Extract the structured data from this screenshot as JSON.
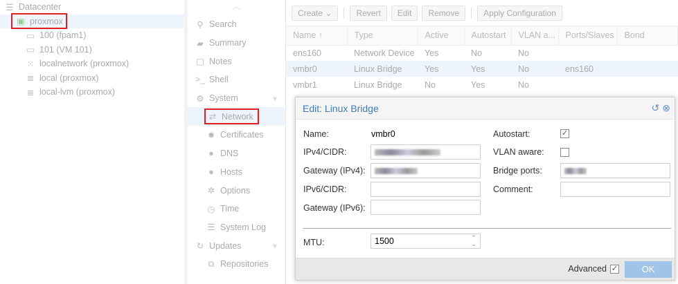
{
  "tree": {
    "items": [
      {
        "label": "Datacenter",
        "icon": "datacenter-icon"
      },
      {
        "label": "proxmox",
        "icon": "node-online-icon"
      },
      {
        "label": "100 (fpam1)",
        "icon": "vm-icon"
      },
      {
        "label": "101 (VM 101)",
        "icon": "vm-icon"
      },
      {
        "label": "localnetwork (proxmox)",
        "icon": "sdn-grid-icon"
      },
      {
        "label": "local (proxmox)",
        "icon": "storage-icon"
      },
      {
        "label": "local-lvm (proxmox)",
        "icon": "storage-icon"
      }
    ]
  },
  "nav": {
    "items": [
      {
        "label": "Search",
        "icon": "search-icon"
      },
      {
        "label": "Summary",
        "icon": "book-icon"
      },
      {
        "label": "Notes",
        "icon": "notes-icon"
      },
      {
        "label": "Shell",
        "icon": "terminal-icon"
      },
      {
        "label": "System",
        "icon": "gears-icon"
      },
      {
        "label": "Network",
        "icon": "exchange-icon"
      },
      {
        "label": "Certificates",
        "icon": "certificate-icon"
      },
      {
        "label": "DNS",
        "icon": "globe-icon"
      },
      {
        "label": "Hosts",
        "icon": "globe-icon"
      },
      {
        "label": "Options",
        "icon": "gear-icon"
      },
      {
        "label": "Time",
        "icon": "clock-icon"
      },
      {
        "label": "System Log",
        "icon": "list-icon"
      },
      {
        "label": "Updates",
        "icon": "refresh-icon"
      },
      {
        "label": "Repositories",
        "icon": "files-icon"
      }
    ]
  },
  "toolbar": {
    "create": "Create",
    "revert": "Revert",
    "edit": "Edit",
    "remove": "Remove",
    "apply": "Apply Configuration"
  },
  "grid": {
    "columns": [
      "Name ↑",
      "Type",
      "Active",
      "Autostart",
      "VLAN a...",
      "Ports/Slaves",
      "Bond"
    ],
    "rows": [
      [
        "ens160",
        "Network Device",
        "Yes",
        "No",
        "No",
        ""
      ],
      [
        "vmbr0",
        "Linux Bridge",
        "Yes",
        "Yes",
        "No",
        "ens160"
      ],
      [
        "vmbr1",
        "Linux Bridge",
        "No",
        "Yes",
        "No",
        ""
      ]
    ]
  },
  "dialog": {
    "title": "Edit: Linux Bridge",
    "name_label": "Name:",
    "name_value": "vmbr0",
    "ipv4_label": "IPv4/CIDR:",
    "gw4_label": "Gateway (IPv4):",
    "ipv6_label": "IPv6/CIDR:",
    "gw6_label": "Gateway (IPv6):",
    "autostart_label": "Autostart:",
    "autostart_checked": true,
    "vlan_label": "VLAN aware:",
    "vlan_checked": false,
    "ports_label": "Bridge ports:",
    "comment_label": "Comment:",
    "mtu_label": "MTU:",
    "mtu_value": "1500",
    "advanced_label": "Advanced",
    "advanced_checked": true,
    "ok": "OK"
  }
}
